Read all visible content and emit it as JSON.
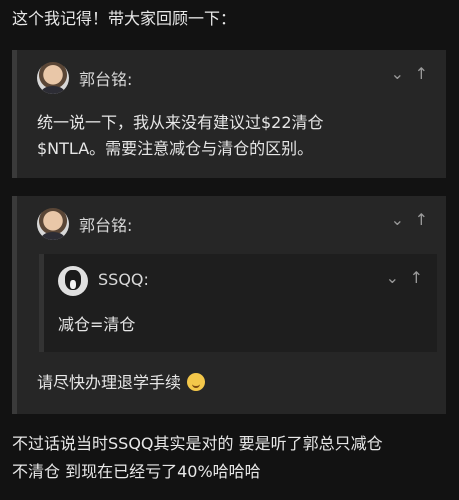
{
  "intro_text": "这个我记得！带大家回顾一下：",
  "quote1": {
    "username": "郭台铭:",
    "line1": "统一说一下，我从来没有建议过$22清仓",
    "line2": "$NTLA。需要注意减仓与清仓的区别。",
    "down_glyph": "⌄",
    "up_glyph": "↑"
  },
  "quote2": {
    "username": "郭台铭:",
    "down_glyph": "⌄",
    "up_glyph": "↑",
    "inner": {
      "username": "SSQQ:",
      "text": "减仓=清仓",
      "down_glyph": "⌄",
      "up_glyph": "↑"
    },
    "reply": "请尽快办理退学手续"
  },
  "footer_line1": "不过话说当时SSQQ其实是对的 要是听了郭总只减仓",
  "footer_line2": "不清仓 到现在已经亏了40%哈哈哈"
}
